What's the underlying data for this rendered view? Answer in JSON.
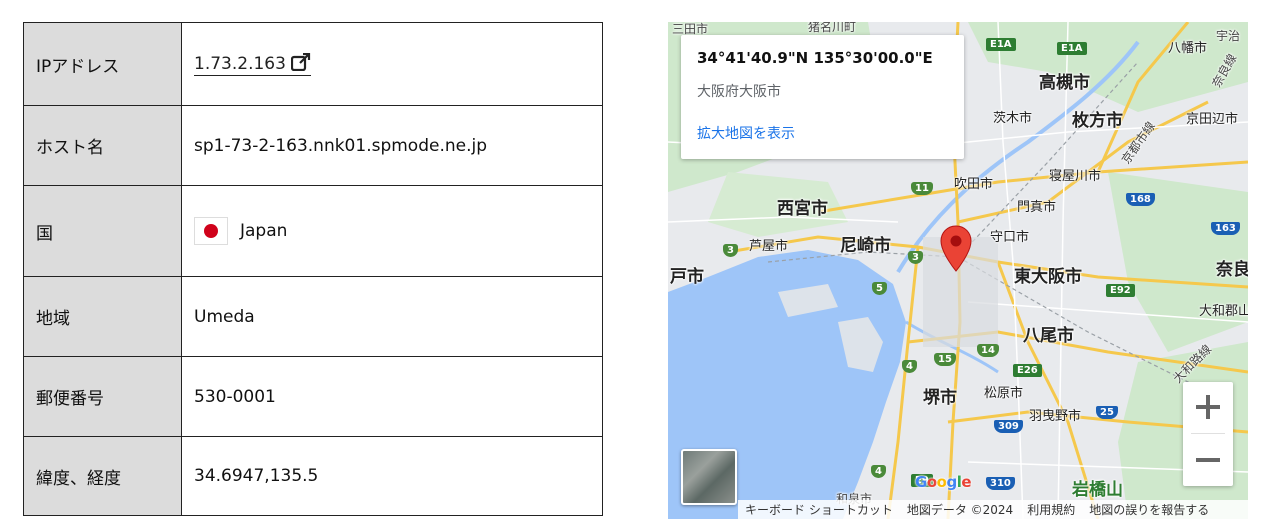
{
  "table": {
    "rows": [
      {
        "label": "IPアドレス",
        "value": "1.73.2.163"
      },
      {
        "label": "ホスト名",
        "value": "sp1-73-2-163.nnk01.spmode.ne.jp"
      },
      {
        "label": "国",
        "value": "Japan"
      },
      {
        "label": "地域",
        "value": "Umeda"
      },
      {
        "label": "郵便番号",
        "value": "530-0001"
      },
      {
        "label": "緯度、経度",
        "value": "34.6947,135.5"
      }
    ]
  },
  "map": {
    "infobox": {
      "coords": "34°41'40.9\"N 135°30'00.0\"E",
      "place": "大阪府大阪市",
      "enlarge_link": "拡大地図を表示"
    },
    "labels": {
      "takatsuki": "高槻市",
      "hirakata": "枚方市",
      "nishinomiya": "西宮市",
      "amagasaki": "尼崎市",
      "higashiosaka": "東大阪市",
      "yao": "八尾市",
      "sakai": "堺市",
      "kobe": "戸市",
      "nara": "奈良",
      "ibaraki": "茨木市",
      "suita": "吹田市",
      "neyagawa": "寝屋川市",
      "kadoma": "門真市",
      "moriguchi": "守口市",
      "ashiya": "芦屋市",
      "matsubara": "松原市",
      "habikino": "羽曳野市",
      "kyotanabe": "京田辺市",
      "yawata": "八幡市",
      "yamatokoriyama": "大和郡山",
      "iwahashi": "岩橋山",
      "sanda": "三田市",
      "inagawa": "猪名川町",
      "uji": "宇治",
      "narakaido": "奈良線",
      "kyotorosen": "京都市線",
      "yamatoroute": "大和路線",
      "izumi": "和泉市"
    },
    "shields": [
      "E1A",
      "E1A",
      "11",
      "3",
      "3",
      "5",
      "15",
      "14",
      "4",
      "4",
      "E26",
      "E92",
      "168",
      "163",
      "25",
      "309",
      "E9",
      "310"
    ],
    "google_logo": "Google",
    "attribution": [
      "キーボード ショートカット",
      "地図データ ©2024",
      "利用規約",
      "地図の誤りを報告する"
    ],
    "colors": {
      "water": "#9ec5f8",
      "land": "#e8eaed",
      "park": "#c8e6c9",
      "road": "#fbd86a",
      "pin": "#ea4335"
    }
  }
}
